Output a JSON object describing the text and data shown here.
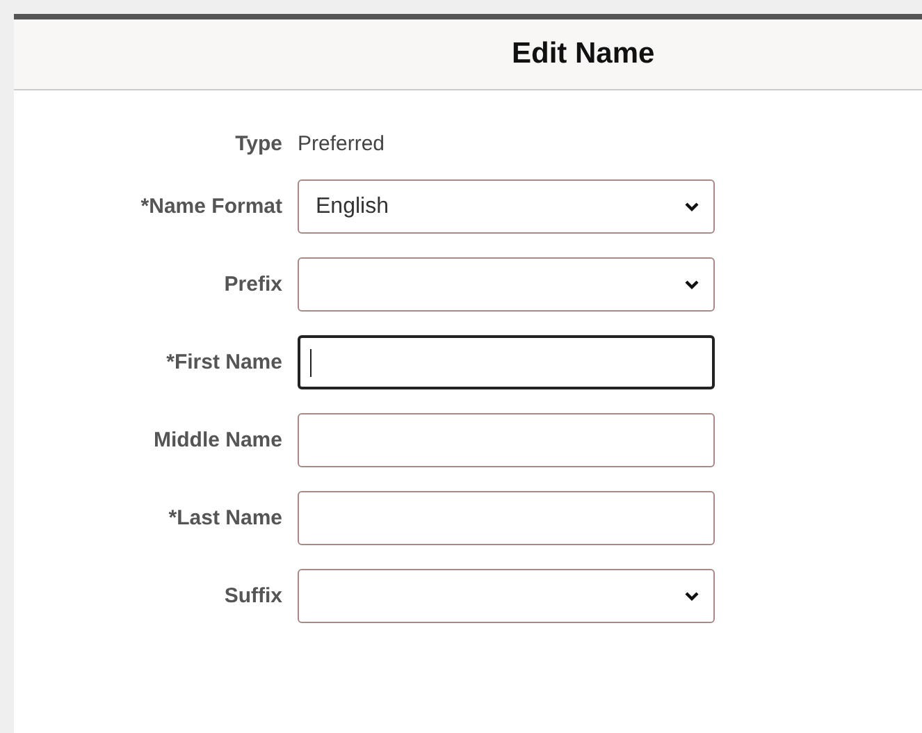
{
  "dialog": {
    "title": "Edit Name"
  },
  "type_row": {
    "label": "Type",
    "value": "Preferred"
  },
  "fields": [
    {
      "label": "*Name Format",
      "kind": "select",
      "value": "English",
      "focused": false
    },
    {
      "label": "Prefix",
      "kind": "select",
      "focused": false
    },
    {
      "label": "*First Name",
      "kind": "text",
      "focused": true
    },
    {
      "label": "Middle Name",
      "kind": "text",
      "focused": false
    },
    {
      "label": "*Last Name",
      "kind": "text",
      "focused": false
    },
    {
      "label": "Suffix",
      "kind": "select",
      "focused": false
    }
  ]
}
